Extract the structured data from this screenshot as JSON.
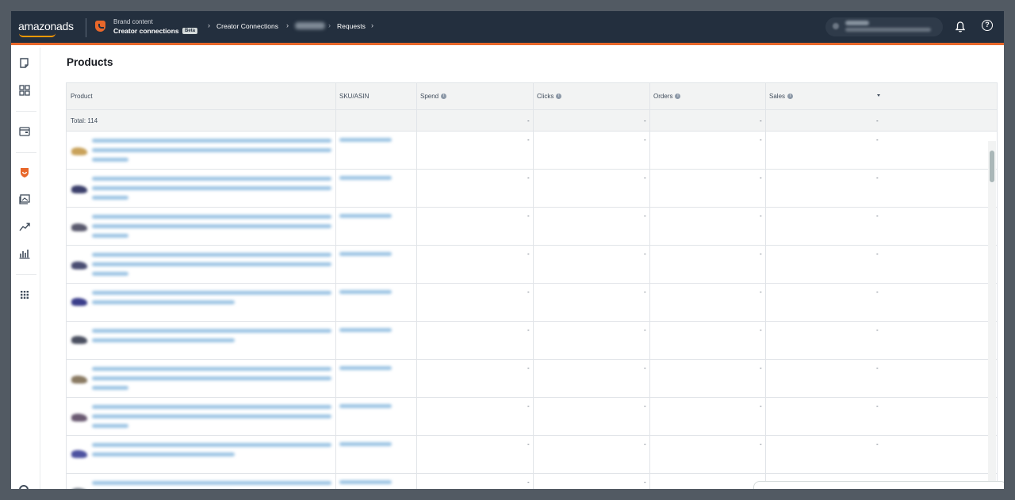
{
  "header": {
    "logo": "amazonads",
    "brand_sub": "Brand content",
    "brand_main": "Creator connections",
    "beta": "Beta",
    "crumb_1": "Creator Connections",
    "crumb_3": "Requests",
    "icons": [
      "bell-icon",
      "help-icon"
    ]
  },
  "sidebar": {
    "icons": [
      "notes-icon",
      "dashboard-icon",
      "wallet-icon",
      "brand-shield-icon",
      "media-icon",
      "trend-icon",
      "bar-chart-icon",
      "apps-grid-icon",
      "settings-icon"
    ]
  },
  "page": {
    "title": "Products"
  },
  "table": {
    "columns": [
      "Product",
      "SKU/ASIN",
      "Spend",
      "Clicks",
      "Orders",
      "Sales"
    ],
    "total_label": "Total: 114",
    "empty_value": "-",
    "row_count_visible": 10
  },
  "colors": {
    "topbar": "#232f3e",
    "accent": "#e8672a",
    "link": "#0972d3"
  }
}
